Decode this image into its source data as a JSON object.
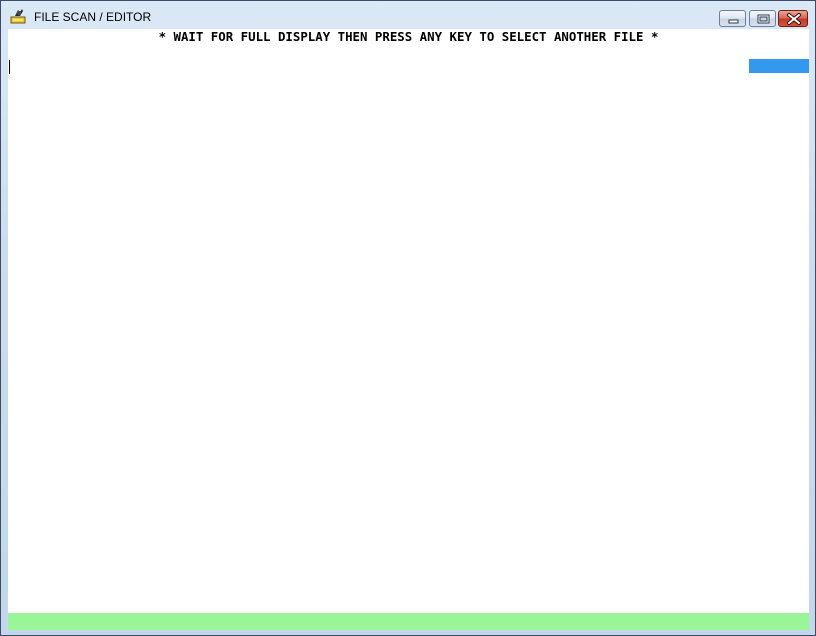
{
  "window": {
    "title": "FILE SCAN / EDITOR",
    "app_icon": "dos-app-icon",
    "controls": {
      "minimize_icon": "minimize-icon",
      "maximize_icon": "restore-icon",
      "close_icon": "close-icon"
    }
  },
  "console": {
    "banner": "* WAIT FOR FULL DISPLAY THEN PRESS ANY KEY TO SELECT ANOTHER FILE *"
  },
  "colors": {
    "highlight": "#3399ee",
    "status_bar": "#98f598",
    "background": "#ffffff"
  }
}
